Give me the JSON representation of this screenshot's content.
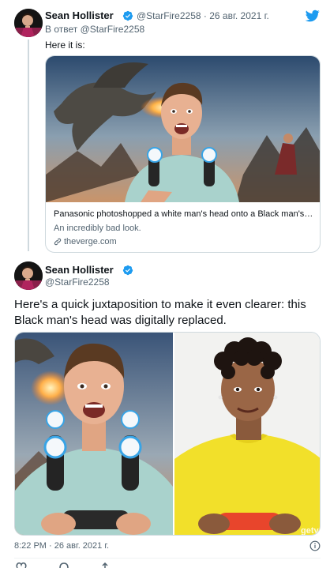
{
  "tweet1": {
    "author_name": "Sean Hollister",
    "handle": "@StarFire2258",
    "separator": "·",
    "date": "26 авг. 2021 г.",
    "reply_to_prefix": "В ответ",
    "reply_to_handle": "@StarFire2258",
    "text": "Here it is:",
    "card": {
      "title": "Panasonic photoshopped a white man's head onto a Black man's body",
      "description": "An incredibly bad look.",
      "domain": "theverge.com"
    }
  },
  "tweet2": {
    "author_name": "Sean Hollister",
    "handle": "@StarFire2258",
    "text": "Here's a quick juxtaposition to make it even clearer: this Black man's head was digitally replaced.",
    "watermark": "gety",
    "time": "8:22 PM",
    "separator": "·",
    "date": "26 авг. 2021 г."
  },
  "colors": {
    "brand_blue": "#1d9bf0",
    "text_primary": "#0f1419",
    "text_secondary": "#536471",
    "border": "#cfd9de",
    "shirt_left": "#a9d2cc",
    "shirt_right": "#f2e02a",
    "controller_red": "#e8452c"
  },
  "icons": {
    "platform": "twitter-bird-icon",
    "verified": "verified-badge-icon",
    "link": "link-icon",
    "info": "info-icon"
  }
}
